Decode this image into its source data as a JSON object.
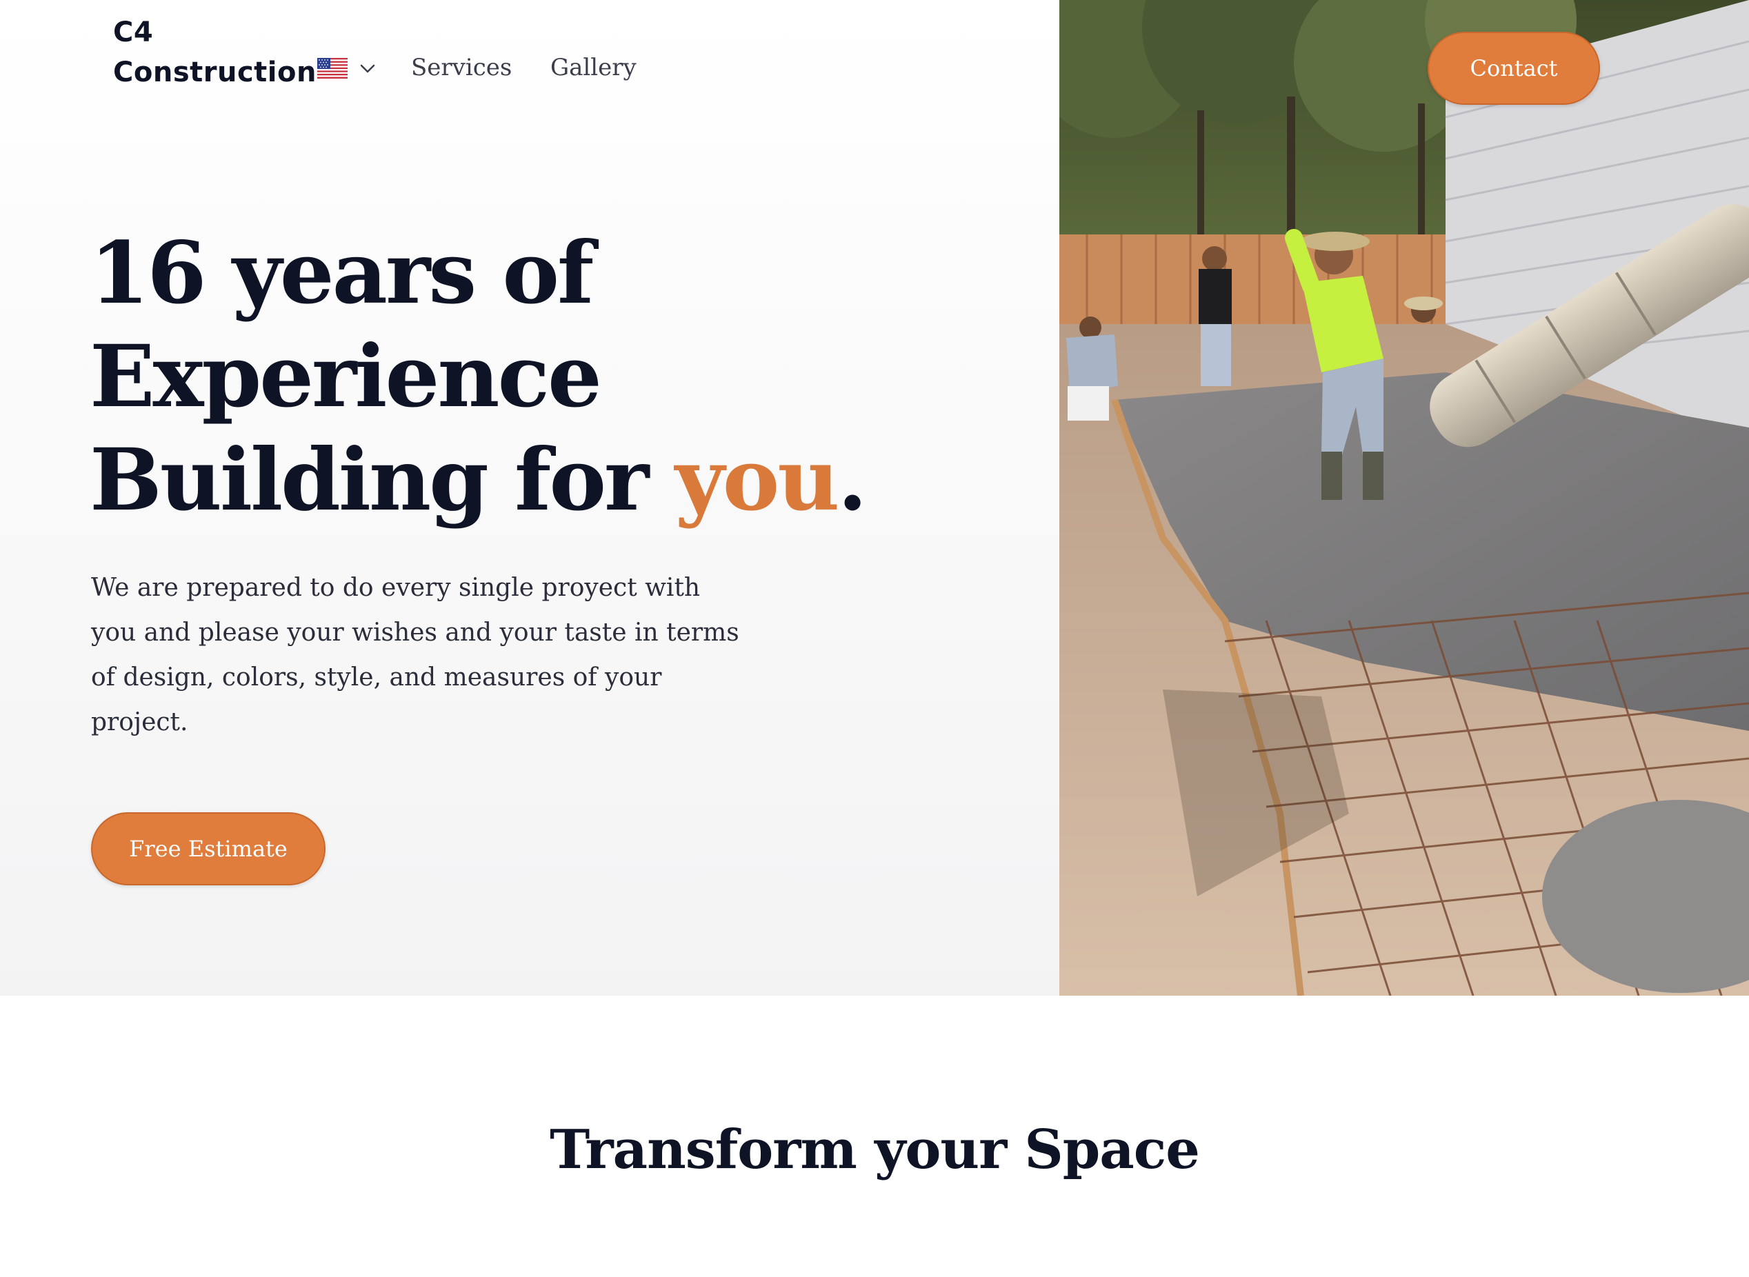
{
  "brand": {
    "line1": "C4",
    "line2": "Construction"
  },
  "nav": {
    "language_icon": "us-flag-icon",
    "dropdown_icon": "chevron-down-icon",
    "links": [
      "Services",
      "Gallery"
    ],
    "contact_label": "Contact"
  },
  "hero": {
    "headline_line1": "16 years of",
    "headline_line2": "Experience",
    "headline_line3_prefix": "Building for ",
    "headline_accent": "you",
    "headline_suffix": ".",
    "subtitle": "We are prepared to do every single proyect with you and please your wishes and your taste in terms of design, colors, style, and measures of your project.",
    "cta_label": "Free Estimate",
    "photo_icon": "construction-photo"
  },
  "section": {
    "title": "Transform your Space"
  },
  "colors": {
    "accent": "#e07c3c",
    "text": "#0e1326"
  }
}
